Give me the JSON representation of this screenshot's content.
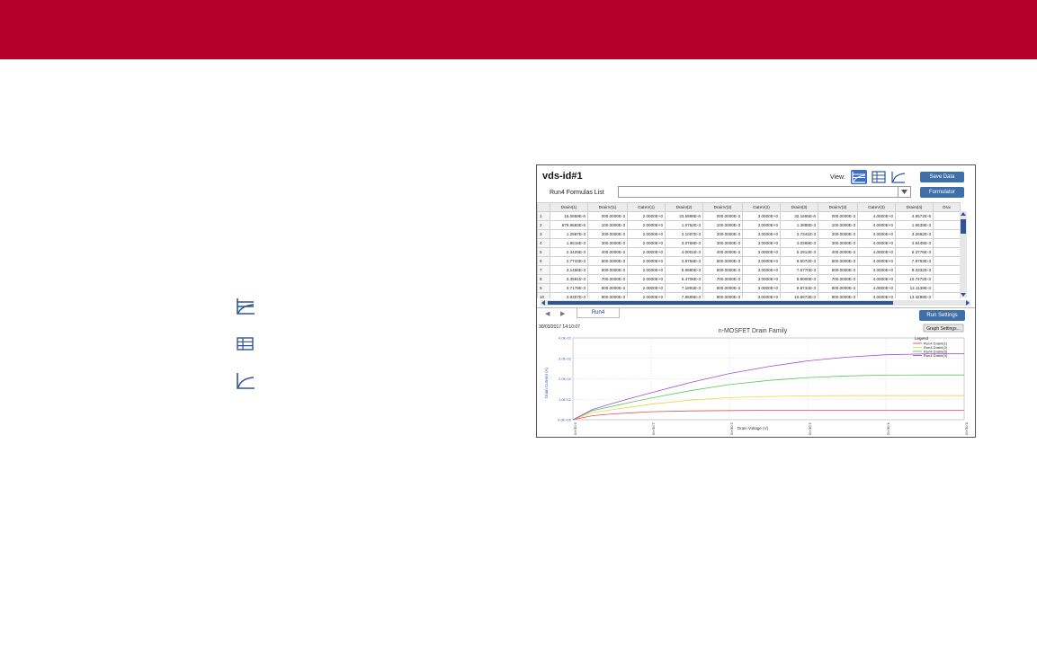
{
  "window": {
    "title": "vds-id#1",
    "view_label": "View:",
    "save_data_label": "Save Data",
    "formulas_label": "Run4 Formulas List",
    "formulas_value": "",
    "formulator_label": "Formulator",
    "run_settings_label": "Run Settings",
    "graph_settings_label": "Graph Settings...",
    "active_tab": "Run4",
    "timestamp": "30/03/2017 14:10:07"
  },
  "left_icons": [
    "table-graph-view-icon",
    "table-view-icon",
    "graph-view-icon"
  ],
  "table": {
    "columns": [
      "",
      "DrainI(1)",
      "DrainV(1)",
      "GateV(1)",
      "DrainI(2)",
      "DrainV(2)",
      "GateV(2)",
      "DrainI(3)",
      "DrainV(3)",
      "GateV(3)",
      "DrainI(4)",
      "Drai"
    ],
    "rows": [
      [
        "1",
        "15.0859E-6",
        "000.0000E-3",
        "2.0000E+0",
        "23.5998E-6",
        "000.0000E-3",
        "3.0000E+0",
        "32.1665E-6",
        "000.0000E-3",
        "4.0000E+0",
        "4.8572E-6",
        ""
      ],
      [
        "2",
        "679.9683E-6",
        "100.0000E-3",
        "2.0000E+0",
        "1.0752E-3",
        "100.0000E-3",
        "3.0000E+0",
        "1.3888E-3",
        "100.0000E-3",
        "4.0000E+0",
        "1.6539E-3",
        ""
      ],
      [
        "3",
        "1.2967E-3",
        "200.0000E-3",
        "2.0000E+0",
        "2.1007E-3",
        "200.0000E-3",
        "3.0000E+0",
        "2.7341E-3",
        "200.0000E-3",
        "4.0000E+0",
        "3.2682E-3",
        ""
      ],
      [
        "4",
        "1.8516E-3",
        "300.0000E-3",
        "2.0000E+0",
        "3.0768E-3",
        "300.0000E-3",
        "3.0000E+0",
        "4.0369E-3",
        "300.0000E-3",
        "4.0000E+0",
        "4.8448E-3",
        ""
      ],
      [
        "5",
        "2.3429E-3",
        "400.0000E-3",
        "2.0000E+0",
        "4.0001E-3",
        "400.0000E-3",
        "3.0000E+0",
        "5.2914E-3",
        "400.0000E-3",
        "4.0000E+0",
        "6.3776E-3",
        ""
      ],
      [
        "6",
        "2.7744E-3",
        "500.0000E-3",
        "2.0000E+0",
        "4.8758E-3",
        "500.0000E-3",
        "3.0000E+0",
        "6.5072E-3",
        "500.0000E-3",
        "4.0000E+0",
        "7.8763E-3",
        ""
      ],
      [
        "7",
        "3.1456E-3",
        "600.0000E-3",
        "2.0000E+0",
        "5.6980E-3",
        "600.0000E-3",
        "3.0000E+0",
        "7.6770E-3",
        "600.0000E-3",
        "4.0000E+0",
        "9.3332E-3",
        ""
      ],
      [
        "8",
        "3.4591E-3",
        "700.0000E-3",
        "2.0000E+0",
        "6.4706E-3",
        "700.0000E-3",
        "3.0000E+0",
        "8.8000E-3",
        "700.0000E-3",
        "4.0000E+0",
        "10.7472E-3",
        ""
      ],
      [
        "9",
        "3.7179E-3",
        "800.0000E-3",
        "2.0000E+0",
        "7.1893E-3",
        "800.0000E-3",
        "3.0000E+0",
        "9.8734E-3",
        "800.0000E-3",
        "4.0000E+0",
        "12.1139E-3",
        ""
      ],
      [
        "10",
        "3.9307E-3",
        "900.0000E-3",
        "2.0000E+0",
        "7.8589E-3",
        "900.0000E-3",
        "3.0000E+0",
        "10.8973E-3",
        "900.0000E-3",
        "4.0000E+0",
        "13.4298E-3",
        ""
      ]
    ]
  },
  "chart_data": {
    "type": "line",
    "title": "n-MOSFET Drain Family",
    "xlabel": "Drain Voltage (V)",
    "ylabel": "Drain Current (A)",
    "xlim": [
      0,
      5
    ],
    "ylim": [
      0,
      0.04
    ],
    "x_ticks": [
      "0.0E+00",
      "1.0E+00",
      "2.0E+00",
      "3.0E+00",
      "4.0E+00",
      "5.0E+00"
    ],
    "y_ticks": [
      "0.0E+00",
      "1.0E-02",
      "2.0E-02",
      "3.0E-02",
      "4.0E-02"
    ],
    "grid": true,
    "legend_title": "Legend",
    "legend_position": "top-right",
    "x": [
      0,
      0.25,
      0.5,
      0.75,
      1.0,
      1.5,
      2.0,
      2.5,
      3.0,
      3.5,
      4.0,
      4.5,
      5.0
    ],
    "series": [
      {
        "name": "Run4 DrainI(1)",
        "color": "#e05050",
        "values": [
          0,
          0.002,
          0.0028,
          0.0034,
          0.0039,
          0.0043,
          0.0045,
          0.0046,
          0.0046,
          0.0046,
          0.0046,
          0.0046,
          0.0046
        ]
      },
      {
        "name": "Run4 DrainI(2)",
        "color": "#e8d84a",
        "values": [
          0,
          0.0035,
          0.0049,
          0.0063,
          0.0076,
          0.0096,
          0.0108,
          0.0114,
          0.0117,
          0.0118,
          0.0118,
          0.0118,
          0.0118
        ]
      },
      {
        "name": "Run4 DrainI(3)",
        "color": "#5ac85a",
        "values": [
          0,
          0.0045,
          0.0065,
          0.0086,
          0.0106,
          0.0142,
          0.0172,
          0.0192,
          0.0206,
          0.0214,
          0.0218,
          0.0219,
          0.0219
        ]
      },
      {
        "name": "Run4 DrainI(4)",
        "color": "#9a50d8",
        "values": [
          0,
          0.005,
          0.0079,
          0.0106,
          0.0132,
          0.0182,
          0.0226,
          0.026,
          0.0288,
          0.0306,
          0.0318,
          0.0322,
          0.0322
        ]
      }
    ]
  }
}
